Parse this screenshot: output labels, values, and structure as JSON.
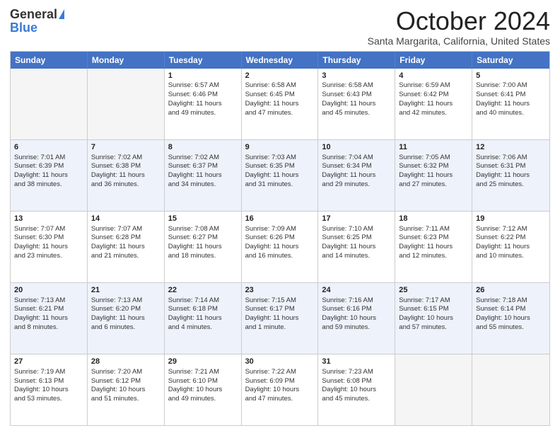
{
  "header": {
    "logo_general": "General",
    "logo_blue": "Blue",
    "month_title": "October 2024",
    "location": "Santa Margarita, California, United States"
  },
  "days_of_week": [
    "Sunday",
    "Monday",
    "Tuesday",
    "Wednesday",
    "Thursday",
    "Friday",
    "Saturday"
  ],
  "weeks": [
    [
      {
        "day": "",
        "lines": []
      },
      {
        "day": "",
        "lines": []
      },
      {
        "day": "1",
        "lines": [
          "Sunrise: 6:57 AM",
          "Sunset: 6:46 PM",
          "Daylight: 11 hours",
          "and 49 minutes."
        ]
      },
      {
        "day": "2",
        "lines": [
          "Sunrise: 6:58 AM",
          "Sunset: 6:45 PM",
          "Daylight: 11 hours",
          "and 47 minutes."
        ]
      },
      {
        "day": "3",
        "lines": [
          "Sunrise: 6:58 AM",
          "Sunset: 6:43 PM",
          "Daylight: 11 hours",
          "and 45 minutes."
        ]
      },
      {
        "day": "4",
        "lines": [
          "Sunrise: 6:59 AM",
          "Sunset: 6:42 PM",
          "Daylight: 11 hours",
          "and 42 minutes."
        ]
      },
      {
        "day": "5",
        "lines": [
          "Sunrise: 7:00 AM",
          "Sunset: 6:41 PM",
          "Daylight: 11 hours",
          "and 40 minutes."
        ]
      }
    ],
    [
      {
        "day": "6",
        "lines": [
          "Sunrise: 7:01 AM",
          "Sunset: 6:39 PM",
          "Daylight: 11 hours",
          "and 38 minutes."
        ]
      },
      {
        "day": "7",
        "lines": [
          "Sunrise: 7:02 AM",
          "Sunset: 6:38 PM",
          "Daylight: 11 hours",
          "and 36 minutes."
        ]
      },
      {
        "day": "8",
        "lines": [
          "Sunrise: 7:02 AM",
          "Sunset: 6:37 PM",
          "Daylight: 11 hours",
          "and 34 minutes."
        ]
      },
      {
        "day": "9",
        "lines": [
          "Sunrise: 7:03 AM",
          "Sunset: 6:35 PM",
          "Daylight: 11 hours",
          "and 31 minutes."
        ]
      },
      {
        "day": "10",
        "lines": [
          "Sunrise: 7:04 AM",
          "Sunset: 6:34 PM",
          "Daylight: 11 hours",
          "and 29 minutes."
        ]
      },
      {
        "day": "11",
        "lines": [
          "Sunrise: 7:05 AM",
          "Sunset: 6:32 PM",
          "Daylight: 11 hours",
          "and 27 minutes."
        ]
      },
      {
        "day": "12",
        "lines": [
          "Sunrise: 7:06 AM",
          "Sunset: 6:31 PM",
          "Daylight: 11 hours",
          "and 25 minutes."
        ]
      }
    ],
    [
      {
        "day": "13",
        "lines": [
          "Sunrise: 7:07 AM",
          "Sunset: 6:30 PM",
          "Daylight: 11 hours",
          "and 23 minutes."
        ]
      },
      {
        "day": "14",
        "lines": [
          "Sunrise: 7:07 AM",
          "Sunset: 6:28 PM",
          "Daylight: 11 hours",
          "and 21 minutes."
        ]
      },
      {
        "day": "15",
        "lines": [
          "Sunrise: 7:08 AM",
          "Sunset: 6:27 PM",
          "Daylight: 11 hours",
          "and 18 minutes."
        ]
      },
      {
        "day": "16",
        "lines": [
          "Sunrise: 7:09 AM",
          "Sunset: 6:26 PM",
          "Daylight: 11 hours",
          "and 16 minutes."
        ]
      },
      {
        "day": "17",
        "lines": [
          "Sunrise: 7:10 AM",
          "Sunset: 6:25 PM",
          "Daylight: 11 hours",
          "and 14 minutes."
        ]
      },
      {
        "day": "18",
        "lines": [
          "Sunrise: 7:11 AM",
          "Sunset: 6:23 PM",
          "Daylight: 11 hours",
          "and 12 minutes."
        ]
      },
      {
        "day": "19",
        "lines": [
          "Sunrise: 7:12 AM",
          "Sunset: 6:22 PM",
          "Daylight: 11 hours",
          "and 10 minutes."
        ]
      }
    ],
    [
      {
        "day": "20",
        "lines": [
          "Sunrise: 7:13 AM",
          "Sunset: 6:21 PM",
          "Daylight: 11 hours",
          "and 8 minutes."
        ]
      },
      {
        "day": "21",
        "lines": [
          "Sunrise: 7:13 AM",
          "Sunset: 6:20 PM",
          "Daylight: 11 hours",
          "and 6 minutes."
        ]
      },
      {
        "day": "22",
        "lines": [
          "Sunrise: 7:14 AM",
          "Sunset: 6:18 PM",
          "Daylight: 11 hours",
          "and 4 minutes."
        ]
      },
      {
        "day": "23",
        "lines": [
          "Sunrise: 7:15 AM",
          "Sunset: 6:17 PM",
          "Daylight: 11 hours",
          "and 1 minute."
        ]
      },
      {
        "day": "24",
        "lines": [
          "Sunrise: 7:16 AM",
          "Sunset: 6:16 PM",
          "Daylight: 10 hours",
          "and 59 minutes."
        ]
      },
      {
        "day": "25",
        "lines": [
          "Sunrise: 7:17 AM",
          "Sunset: 6:15 PM",
          "Daylight: 10 hours",
          "and 57 minutes."
        ]
      },
      {
        "day": "26",
        "lines": [
          "Sunrise: 7:18 AM",
          "Sunset: 6:14 PM",
          "Daylight: 10 hours",
          "and 55 minutes."
        ]
      }
    ],
    [
      {
        "day": "27",
        "lines": [
          "Sunrise: 7:19 AM",
          "Sunset: 6:13 PM",
          "Daylight: 10 hours",
          "and 53 minutes."
        ]
      },
      {
        "day": "28",
        "lines": [
          "Sunrise: 7:20 AM",
          "Sunset: 6:12 PM",
          "Daylight: 10 hours",
          "and 51 minutes."
        ]
      },
      {
        "day": "29",
        "lines": [
          "Sunrise: 7:21 AM",
          "Sunset: 6:10 PM",
          "Daylight: 10 hours",
          "and 49 minutes."
        ]
      },
      {
        "day": "30",
        "lines": [
          "Sunrise: 7:22 AM",
          "Sunset: 6:09 PM",
          "Daylight: 10 hours",
          "and 47 minutes."
        ]
      },
      {
        "day": "31",
        "lines": [
          "Sunrise: 7:23 AM",
          "Sunset: 6:08 PM",
          "Daylight: 10 hours",
          "and 45 minutes."
        ]
      },
      {
        "day": "",
        "lines": []
      },
      {
        "day": "",
        "lines": []
      }
    ]
  ]
}
